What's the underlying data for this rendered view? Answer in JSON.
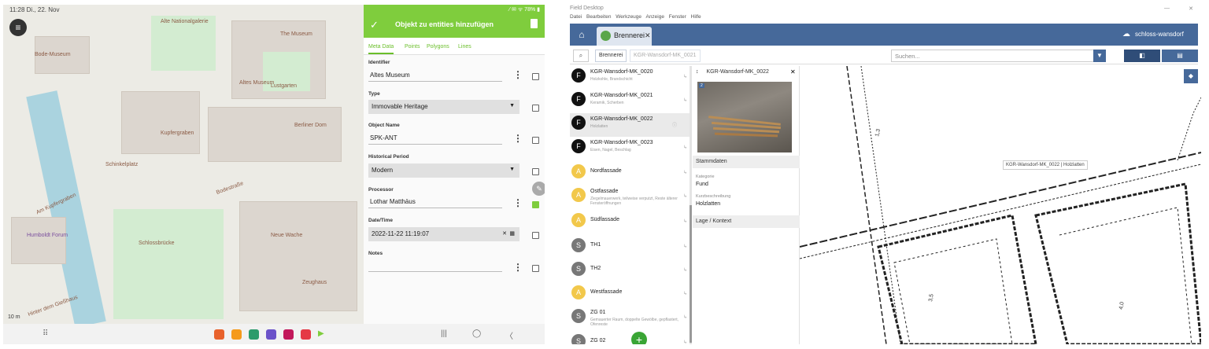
{
  "tablet": {
    "status_time": "11:28 Di., 22. Nov",
    "status_right": "⁄ ✉ ᯤ 78% ▮",
    "map_labels": [
      {
        "text": "Alte Nationalgalerie",
        "style": "brown"
      },
      {
        "text": "The Museum",
        "style": "brown"
      },
      {
        "text": "Altes Museum",
        "style": "brown"
      },
      {
        "text": "Bode-Museum",
        "style": "brown"
      },
      {
        "text": "Lustgarten",
        "style": "brown"
      },
      {
        "text": "Berliner Dom",
        "style": "brown"
      },
      {
        "text": "Kupfergraben",
        "style": "brown"
      },
      {
        "text": "Bodestraße",
        "style": "brown"
      },
      {
        "text": "Am Kupfergraben",
        "style": "brown"
      },
      {
        "text": "Schinkelplatz",
        "style": "brown"
      },
      {
        "text": "Humboldt Forum",
        "style": "purple"
      },
      {
        "text": "Schlossbrücke",
        "style": "brown"
      },
      {
        "text": "Neue Wache",
        "style": "brown"
      },
      {
        "text": "Zeughaus",
        "style": "brown"
      },
      {
        "text": "Hinter dem Gießhaus",
        "style": "brown"
      }
    ],
    "scale_label": "10 m",
    "form": {
      "title": "Objekt zu entities hinzufügen",
      "tabs": [
        "Meta Data",
        "Points",
        "Polygons",
        "Lines"
      ],
      "fields": [
        {
          "label": "Identifier",
          "value": "Altes Museum",
          "type": "text",
          "checked": false
        },
        {
          "label": "Type",
          "value": "Immovable Heritage",
          "type": "select",
          "checked": false
        },
        {
          "label": "Object Name",
          "value": "SPK-ANT",
          "type": "text",
          "checked": false
        },
        {
          "label": "Historical Period",
          "value": "Modern",
          "type": "select",
          "checked": false
        },
        {
          "label": "Processor",
          "value": "Lothar Matthäus",
          "type": "text",
          "checked": true
        },
        {
          "label": "Date/Time",
          "value": "2022-11-22 11:19:07",
          "type": "datetime",
          "checked": false
        },
        {
          "label": "Notes",
          "value": "",
          "type": "text",
          "checked": false
        }
      ]
    },
    "navbar": {
      "apps_icon": "⠿",
      "recents": "|||",
      "home": "◯",
      "back": "〈"
    }
  },
  "desktop": {
    "app_title": "Field Desktop",
    "menu": [
      "Datei",
      "Bearbeiten",
      "Werkzeuge",
      "Anzeige",
      "Fenster",
      "Hilfe"
    ],
    "project_tab": "Brennerei",
    "server_label": "schloss-wansdorf",
    "breadcrumbs": [
      "Brennerei",
      "KGR-Wansdorf-MK_0021"
    ],
    "search_placeholder": "Suchen...",
    "list": [
      {
        "title": "KGR-Wansdorf-MK_0020",
        "subtitle": "Holzkohle, Brandschicht",
        "avatar": "F",
        "color": "black"
      },
      {
        "title": "KGR-Wansdorf-MK_0021",
        "subtitle": "Keramik, Scherben",
        "avatar": "F",
        "color": "black"
      },
      {
        "title": "KGR-Wansdorf-MK_0022",
        "subtitle": "Holzlatten",
        "avatar": "F",
        "color": "black",
        "selected": true
      },
      {
        "title": "KGR-Wansdorf-MK_0023",
        "subtitle": "Eisen, Nagel, Beschlag",
        "avatar": "F",
        "color": "black"
      },
      {
        "title": "Nordfassade",
        "subtitle": "",
        "avatar": "A",
        "color": "yellow"
      },
      {
        "title": "Ostfassade",
        "subtitle": "Ziegelmauerwerk, teilweise verputzt, Reste älterer Fensteröffnungen",
        "avatar": "A",
        "color": "yellow"
      },
      {
        "title": "Südfassade",
        "subtitle": "",
        "avatar": "A",
        "color": "yellow"
      },
      {
        "title": "TH1",
        "subtitle": "",
        "avatar": "S",
        "color": "grey"
      },
      {
        "title": "TH2",
        "subtitle": "",
        "avatar": "S",
        "color": "grey"
      },
      {
        "title": "Westfassade",
        "subtitle": "",
        "avatar": "A",
        "color": "yellow"
      },
      {
        "title": "ZG 01",
        "subtitle": "Gemauerter Raum, doppelte Gewölbe, gepflastert, Ofenreste",
        "avatar": "S",
        "color": "grey"
      },
      {
        "title": "ZG 02",
        "subtitle": "",
        "avatar": "S",
        "color": "grey"
      }
    ],
    "detail": {
      "header": "KGR-Wansdorf-MK_0022",
      "image_count": "2",
      "section1": "Stammdaten",
      "category_label": "Kategorie",
      "category_value": "Fund",
      "desc_label": "Kurzbeschreibung",
      "desc_value": "Holzlatten",
      "section2": "Lage / Kontext"
    },
    "plan": {
      "tooltip": "KGR-Wansdorf-MK_0022 | Holzlatten"
    }
  }
}
